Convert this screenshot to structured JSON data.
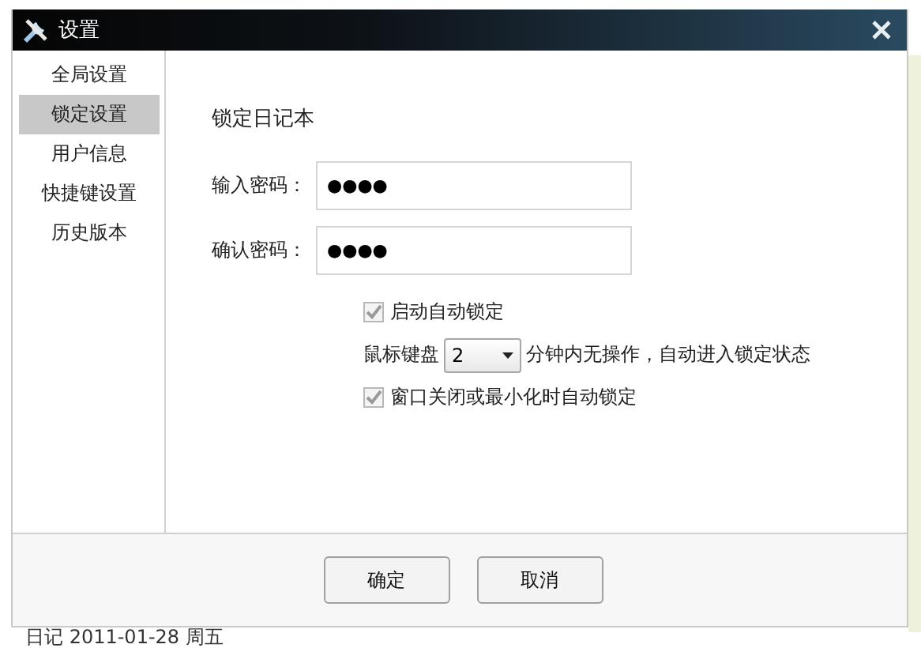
{
  "window": {
    "title": "设置"
  },
  "sidebar": {
    "items": [
      {
        "label": "全局设置",
        "selected": false
      },
      {
        "label": "锁定设置",
        "selected": true
      },
      {
        "label": "用户信息",
        "selected": false
      },
      {
        "label": "快捷键设置",
        "selected": false
      },
      {
        "label": "历史版本",
        "selected": false
      }
    ]
  },
  "section_title": "锁定日记本",
  "fields": [
    {
      "label": "输入密码：",
      "value": "●●●●"
    },
    {
      "label": "确认密码：",
      "value": "●●●●"
    }
  ],
  "options": [
    {
      "kind": "checkbox",
      "label": "启动自动锁定",
      "checked": true
    },
    {
      "kind": "idle",
      "prefix": "鼠标键盘",
      "value": "2",
      "suffix": "分钟内无操作，自动进入锁定状态"
    },
    {
      "kind": "checkbox",
      "label": "窗口关闭或最小化时自动锁定",
      "checked": true
    }
  ],
  "buttons": [
    "确定",
    "取消"
  ],
  "background": {
    "entries": [
      "日记 2011-01-28 周五"
    ]
  }
}
